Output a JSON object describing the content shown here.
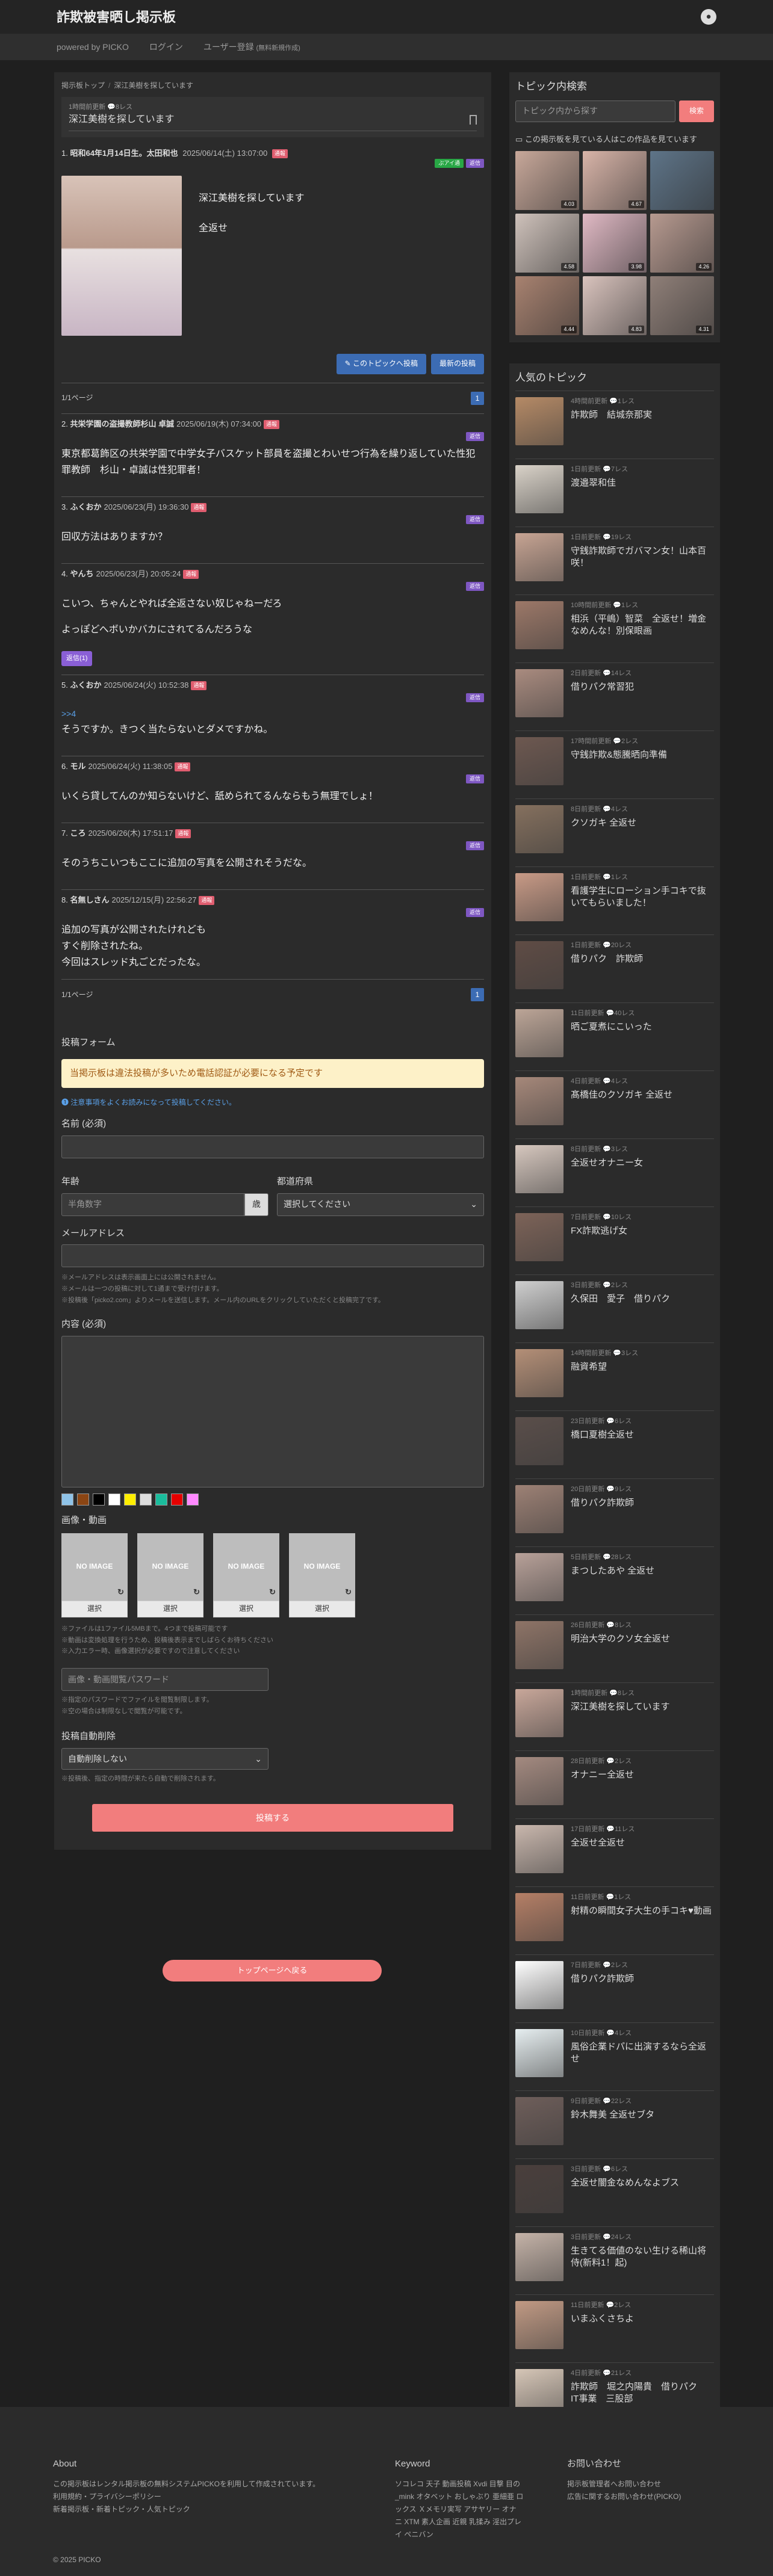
{
  "site": {
    "title": "詐欺被害晒し掲示板",
    "user_icon": "user-circle-icon"
  },
  "nav": {
    "powered": "powered by PICKO",
    "login": "ログイン",
    "register": "ユーザー登録",
    "register_note": "(無料新規作成)"
  },
  "breadcrumb": {
    "home": "掲示板トップ",
    "current": "深江美樹を探しています"
  },
  "topic": {
    "meta": "1時間前更新 💬8レス",
    "title": "深江美樹を探しています"
  },
  "op": {
    "num": "1.",
    "name": "昭和64年1月14日生。太田和也",
    "date": "2025/06/14(土) 13:07:00",
    "badge": "通報",
    "tag1": "ぷアイ通",
    "tag2": "返信",
    "body1": "深江美樹を探しています",
    "body2": "全返せ"
  },
  "op_buttons": {
    "post_this": "このトピックへ投稿",
    "latest": "最新の投稿"
  },
  "pager": {
    "label": "1/1ページ",
    "page": "1"
  },
  "posts": [
    {
      "num": "2.",
      "name": "共栄学園の盗撮教師杉山 卓誠",
      "date": "2025/06/19(木) 07:34:00",
      "badge": "通報",
      "reply": "返信",
      "lines": [
        "東京都葛飾区の共栄学園で中学女子バスケット部員を盗撮とわいせつ行為を繰り返していた性犯罪教師　杉山・卓誠は性犯罪者！"
      ]
    },
    {
      "num": "3.",
      "name": "ふくおか",
      "date": "2025/06/23(月) 19:36:30",
      "badge": "通報",
      "reply": "返信",
      "lines": [
        "回収方法はありますか？"
      ]
    },
    {
      "num": "4.",
      "name": "やんち",
      "date": "2025/06/23(月) 20:05:24",
      "badge": "通報",
      "reply": "返信",
      "lines": [
        "こいつ、ちゃんとやれば全返さない奴じゃねーだろ",
        "よっぽどへボいかバカにされてるんだろうな"
      ],
      "chip": "返信(1)"
    },
    {
      "num": "5.",
      "name": "ふくおか",
      "date": "2025/06/24(火) 10:52:38",
      "badge": "通報",
      "reply": "返信",
      "anchor": ">>4",
      "lines": [
        "そうですか。きつく当たらないとダメですかね。"
      ]
    },
    {
      "num": "6.",
      "name": "モル",
      "date": "2025/06/24(火) 11:38:05",
      "badge": "通報",
      "reply": "返信",
      "lines": [
        "いくら貸してんのか知らないけど、舐められてるんならもう無理でしょ！"
      ]
    },
    {
      "num": "7.",
      "name": "ころ",
      "date": "2025/06/26(木) 17:51:17",
      "badge": "通報",
      "reply": "返信",
      "lines": [
        "そのうちこいつもここに追加の写真を公開されそうだな。"
      ]
    },
    {
      "num": "8.",
      "name": "名無しさん",
      "date": "2025/12/15(月) 22:56:27",
      "badge": "通報",
      "reply": "返信",
      "lines": [
        "追加の写真が公開されたけれども",
        "すぐ削除されたね。",
        "今回はスレッド丸ごとだったな。"
      ]
    }
  ],
  "form": {
    "title": "投稿フォーム",
    "notice": "当掲示板は違法投稿が多いため電話認証が必要になる予定です",
    "note": "注意事項をよくお読みになって投稿してください。",
    "name_label": "名前 (必須)",
    "age_label": "年齢",
    "age_placeholder": "半角数字",
    "age_unit": "歳",
    "pref_label": "都道府県",
    "pref_value": "選択してください",
    "email_label": "メールアドレス",
    "email_help": [
      "※メールアドレスは表示画面上には公開されません。",
      "※メールは一つの投稿に対して1通まで受け付けます。",
      "※投稿後「picko2.com」よりメールを送信します。メール内のURLをクリックしていただくと投稿完了です。"
    ],
    "content_label": "内容 (必須)",
    "colors": [
      "#8fc3e8",
      "#8b4513",
      "#000000",
      "#ffffff",
      "#ffee00",
      "#dddddd",
      "#1abc9c",
      "#e60000",
      "#ff88ff"
    ],
    "media_label": "画像・動画",
    "no_image": "NO IMAGE",
    "select": "選択",
    "media_help": [
      "※ファイルは1ファイル5MBまで。4つまで投稿可能です",
      "※動画は変換処理を行うため、投稿後表示までしばらくお待ちください",
      "※入力エラー時、画像選択が必要ですので注意してください"
    ],
    "password_placeholder": "画像・動画閲覧パスワード",
    "password_help": [
      "※指定のパスワードでファイルを閲覧制限します。",
      "※空の場合は制限なしで閲覧が可能です。"
    ],
    "autodelete_label": "投稿自動削除",
    "autodelete_value": "自動削除しない",
    "autodelete_help": "※投稿後、指定の時間が来たら自動で削除されます。",
    "submit": "投稿する"
  },
  "back_button": "トップページへ戻る",
  "sidebar": {
    "search_title": "トピック内検索",
    "search_placeholder": "トピック内から探す",
    "search_btn": "検索",
    "works_title": "この掲示板を見ている人はこの作品を見ています",
    "works": [
      {
        "count": "4.03",
        "color": "#c8a89a"
      },
      {
        "count": "4.67",
        "color": "#d8b4a8"
      },
      {
        "count": "",
        "color": "#5e7488"
      },
      {
        "count": "4.58",
        "color": "#cfc2bb"
      },
      {
        "count": "3.98",
        "color": "#e0b9c4"
      },
      {
        "count": "4.26",
        "color": "#b79a90"
      },
      {
        "count": "4.44",
        "color": "#a88270"
      },
      {
        "count": "4.83",
        "color": "#d9c3bd"
      },
      {
        "count": "4.31",
        "color": "#8f7f78"
      }
    ],
    "popular_title": "人気のトピック",
    "popular": [
      {
        "meta": "4時間前更新 💬1レス",
        "title": "詐欺師　結城奈那実",
        "color": "#b58a66"
      },
      {
        "meta": "1日前更新 💬7レス",
        "title": "渡邉翠和佳",
        "color": "#d9d2c8"
      },
      {
        "meta": "1日前更新 💬19レス",
        "title": "守銭詐欺師でガバマン女！山本百咲！",
        "color": "#c7a493"
      },
      {
        "meta": "10時間前更新 💬1レス",
        "title": "相浜（平嶋）智菜　全返せ！増金なめんな！別保眼画",
        "color": "#9c7868"
      },
      {
        "meta": "2日前更新 💬14レス",
        "title": "借りパク常習犯",
        "color": "#a98b7f"
      },
      {
        "meta": "17時間前更新 💬2レス",
        "title": "守銭詐欺&態騰晒向準備",
        "color": "#6d5850"
      },
      {
        "meta": "8日前更新 💬4レス",
        "title": "クソガキ 全返せ",
        "color": "#85705e"
      },
      {
        "meta": "1日前更新 💬1レス",
        "title": "看護学生にローション手コキで抜いてもらいました！",
        "color": "#c89a86"
      },
      {
        "meta": "1日前更新 💬20レス",
        "title": "借りパク　詐欺師",
        "color": "#5f4c45"
      },
      {
        "meta": "11日前更新 💬40レス",
        "title": "晒ご夏煮にこいった",
        "color": "#bca597"
      },
      {
        "meta": "4日前更新 💬4レス",
        "title": "髙橋佳のクソガキ 全返せ",
        "color": "#a6887a"
      },
      {
        "meta": "8日前更新 💬3レス",
        "title": "全返せオナニー女",
        "color": "#d6c7be"
      },
      {
        "meta": "7日前更新 💬10レス",
        "title": "FX詐欺逃げ女",
        "color": "#7d6358"
      },
      {
        "meta": "3日前更新 💬2レス",
        "title": "久保田　愛子　借りパク",
        "color": "#cfcfcf"
      },
      {
        "meta": "14時間前更新 💬3レス",
        "title": "融資希望",
        "color": "#b48f77"
      },
      {
        "meta": "23日前更新 💬6レス",
        "title": "橋口夏樹全返せ",
        "color": "#5a4e4a"
      },
      {
        "meta": "20日前更新 💬9レス",
        "title": "借りパク詐欺師",
        "color": "#9d8175"
      },
      {
        "meta": "5日前更新 💬28レス",
        "title": "まつしたあや 全返せ",
        "color": "#b8a199"
      },
      {
        "meta": "26日前更新 💬8レス",
        "title": "明治大学のクソ女全返せ",
        "color": "#8e7467"
      },
      {
        "meta": "1時間前更新 💬8レス",
        "title": "深江美樹を探しています",
        "color": "#c8a79a"
      },
      {
        "meta": "28日前更新 💬2レス",
        "title": "オナニー全返せ",
        "color": "#a48a80"
      },
      {
        "meta": "17日前更新 💬11レス",
        "title": "全返せ全返せ",
        "color": "#c9b7ad"
      },
      {
        "meta": "11日前更新 💬1レス",
        "title": "射精の瞬間女子大生の手コキ♥動画",
        "color": "#b57f66"
      },
      {
        "meta": "7日前更新 💬2レス",
        "title": "借りパク詐欺師",
        "color": "#ffffff"
      },
      {
        "meta": "10日前更新 💬4レス",
        "title": "風俗企業ドパに出演するなら全返せ",
        "color": "#e6eef0"
      },
      {
        "meta": "9日前更新 💬22レス",
        "title": "鈴木舞美 全返せブタ",
        "color": "#6e5e5a"
      },
      {
        "meta": "3日前更新 💬6レス",
        "title": "全返せ闇金なめんなよブス",
        "color": "#4a3f3c"
      },
      {
        "meta": "3日前更新 💬24レス",
        "title": "生きてる価値のない生ける稀山将侍(新料1！起)",
        "color": "#c5b3a8"
      },
      {
        "meta": "11日前更新 💬2レス",
        "title": "いまふくさちよ",
        "color": "#c19a84"
      },
      {
        "meta": "4日前更新 💬21レス",
        "title": "詐欺師　堀之内陽貴　借りパク　IT事業　三股部",
        "color": "#d6c6b7"
      }
    ]
  },
  "footer": {
    "about_title": "About",
    "about_lines": [
      "この掲示板はレンタル掲示板の無料システムPICKOを利用して作成されています。",
      "利用規約・プライバシーポリシー",
      "新着掲示板・新着トピック・人気トピック"
    ],
    "keyword_title": "Keyword",
    "keyword_lines": [
      "ソコレコ 天子 動画投稿 Xvdi 目撃 目の",
      "_mink オタベット おしゃぶり 亜細亜 ロ",
      "ックス Ｘメモリ実写 アサヤリー オナ",
      "ニ XTM 素人企画 近親 乳揉み 淫出プレ",
      "イ ペニバン"
    ],
    "contact_title": "お問い合わせ",
    "contact_lines": [
      "掲示板管理者へお問い合わせ",
      "広告に関するお問い合わせ(PICKO)"
    ],
    "copyright": "© 2025 PICKO"
  }
}
